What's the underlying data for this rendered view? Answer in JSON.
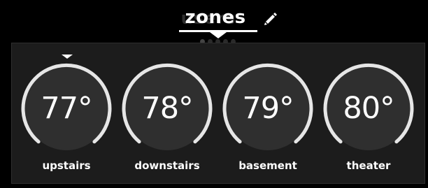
{
  "header": {
    "title": "zones",
    "ghost_title": "users"
  },
  "icons": {
    "edit": "pencil-icon"
  },
  "zones": [
    {
      "name": "upstairs",
      "temp": "77°",
      "selected": true
    },
    {
      "name": "downstairs",
      "temp": "78°",
      "selected": false
    },
    {
      "name": "basement",
      "temp": "79°",
      "selected": false
    },
    {
      "name": "theater",
      "temp": "80°",
      "selected": false
    }
  ],
  "colors": {
    "background": "#000000",
    "panel": "#1c1c1c",
    "dial_face": "#2f2f2f",
    "dial_arc": "#e6e6e6",
    "text": "#ffffff"
  }
}
